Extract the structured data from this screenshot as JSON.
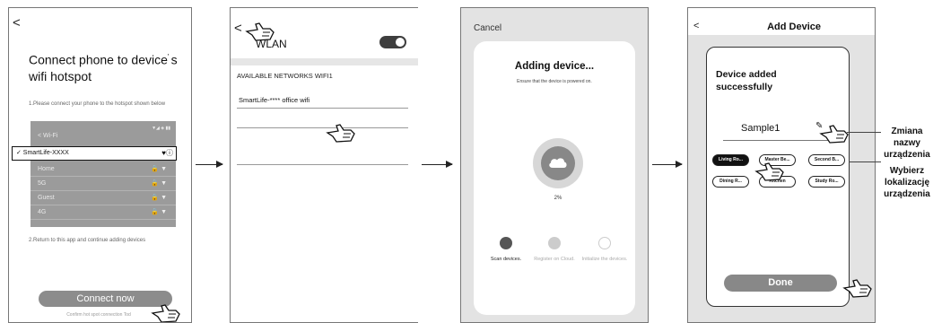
{
  "screen1": {
    "back_icon": "back-arrow-icon",
    "title": "Connect phone to device",
    "title_sup": "' ",
    "title_end": "s wifi hotspot",
    "step1_text": "1.Please connect your phone to the hotspot shown below",
    "wifi_title": "< Wi-Fi",
    "wifi_status": "▼◢ ◈ ▮▮",
    "selected_network": "✓ SmartLife-XXXX",
    "networks": [
      "Home",
      "5G",
      "Guest",
      "4G"
    ],
    "step2_text": "2.Return to this app and continue adding devices",
    "connect_button": "Connect now",
    "confirm_text": "Confirm hot spot connection Tod"
  },
  "screen2": {
    "back_icon": "back-arrow-icon",
    "title": "WLAN",
    "toggle_state": "on",
    "available_label": "AVAILABLE NETWORKS WIFI1",
    "network_1": "SmartLife-**** office wifi"
  },
  "screen3": {
    "cancel": "Cancel",
    "heading": "Adding device...",
    "subtext": "Ensure that the device is powered on.",
    "progress_text": "2%",
    "steps": [
      {
        "label": "Scan devices.",
        "icon": "scan-icon"
      },
      {
        "label": "Register on Cloud.",
        "icon": "cloud-icon"
      },
      {
        "label": "Initialize the devices.",
        "icon": "refresh-icon"
      }
    ]
  },
  "screen4": {
    "back_icon": "back-arrow-icon",
    "title": "Add Device",
    "success_text": "Device added successfully",
    "device_name": "Sample1",
    "rooms": [
      {
        "label": "Living Ro...",
        "active": true
      },
      {
        "label": "Master Be...",
        "active": false
      },
      {
        "label": "Second B...",
        "active": false
      },
      {
        "label": "Dining R...",
        "active": false
      },
      {
        "label": "Kitchen",
        "active": false
      },
      {
        "label": "Study Ro...",
        "active": false
      }
    ],
    "done_button": "Done"
  },
  "annotations": {
    "rename": "Zmiana nazwy urządzenia",
    "location": "Wybierz lokalizację urządzenia"
  },
  "colors": {
    "button_gray": "#8c8c8c",
    "screen_gray": "#e3e3e3",
    "toggle_dark": "#3e3e3e",
    "chip_active": "#111111"
  }
}
